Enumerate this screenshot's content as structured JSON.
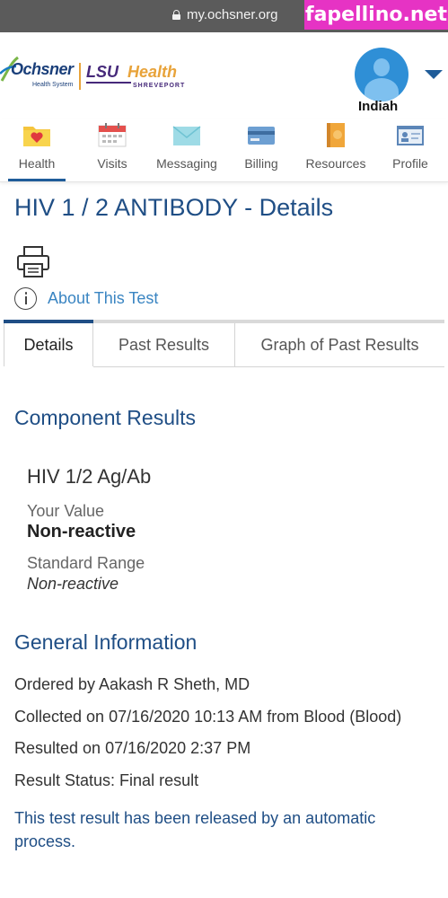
{
  "browser": {
    "url": "my.ochsner.org"
  },
  "watermark": "fapellino.net",
  "header": {
    "logo_ochsner": "Ochsner",
    "logo_ochsner_sub": "Health System",
    "logo_lsu": "LSU",
    "logo_health": "Health",
    "logo_shreveport": "SHREVEPORT",
    "username": "Indiah"
  },
  "nav": {
    "items": [
      {
        "label": "Health",
        "icon": "heart-folder-icon"
      },
      {
        "label": "Visits",
        "icon": "calendar-icon"
      },
      {
        "label": "Messaging",
        "icon": "envelope-icon"
      },
      {
        "label": "Billing",
        "icon": "credit-card-icon"
      },
      {
        "label": "Resources",
        "icon": "book-icon"
      },
      {
        "label": "Profile",
        "icon": "id-card-icon"
      }
    ],
    "active": "Health"
  },
  "page": {
    "title": "HIV 1 / 2 ANTIBODY - Details",
    "about_link": "About This Test"
  },
  "tabs": [
    "Details",
    "Past Results",
    "Graph of Past Results"
  ],
  "component_results": {
    "heading": "Component Results",
    "name": "HIV 1/2 Ag/Ab",
    "your_value_label": "Your Value",
    "your_value": "Non-reactive",
    "standard_range_label": "Standard Range",
    "standard_range": "Non-reactive"
  },
  "general_information": {
    "heading": "General Information",
    "ordered_by": "Ordered by Aakash R Sheth, MD",
    "collected": "Collected on 07/16/2020 10:13 AM from Blood (Blood)",
    "resulted": "Resulted on 07/16/2020 2:37 PM",
    "status": "Result Status: Final result",
    "release_note": "This test result has been released by an automatic process."
  },
  "colors": {
    "brand_blue": "#1f4e85",
    "link_blue": "#3a85c2",
    "avatar_blue": "#2f8fd6",
    "watermark_pink": "#e633c4"
  }
}
